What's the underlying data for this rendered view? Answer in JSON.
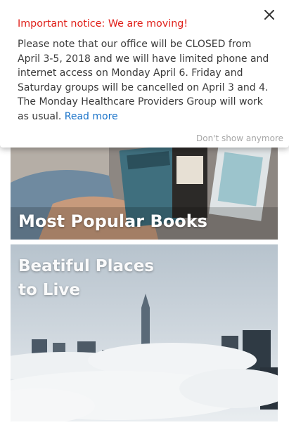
{
  "notice": {
    "title": "Important notice: We are moving!",
    "body_text": "Please note that our office will be CLOSED from April 3-5, 2018 and we will have limited phone and internet access on Monday April 6. Friday and Saturday groups will be cancelled on April 3 and 4. The Monday Healthcare Providers Group will work as usual. ",
    "read_more": "Read more",
    "dont_show": "Don't show anymore",
    "close_icon": "close-icon"
  },
  "cards": [
    {
      "title": "Most Popular Books",
      "image_label": "books-photo",
      "book_covers": [
        "la distancia",
        "LOST AS SEA",
        "READER",
        "L'ORDINAIRE REMÉDIÉ"
      ]
    },
    {
      "title": "Beatiful Places\nto Live",
      "image_label": "city-above-clouds-photo"
    }
  ],
  "colors": {
    "notice_title": "#e0211b",
    "link": "#1a73c9",
    "body_text": "#3a3a3a",
    "muted": "#a7a7a7"
  }
}
